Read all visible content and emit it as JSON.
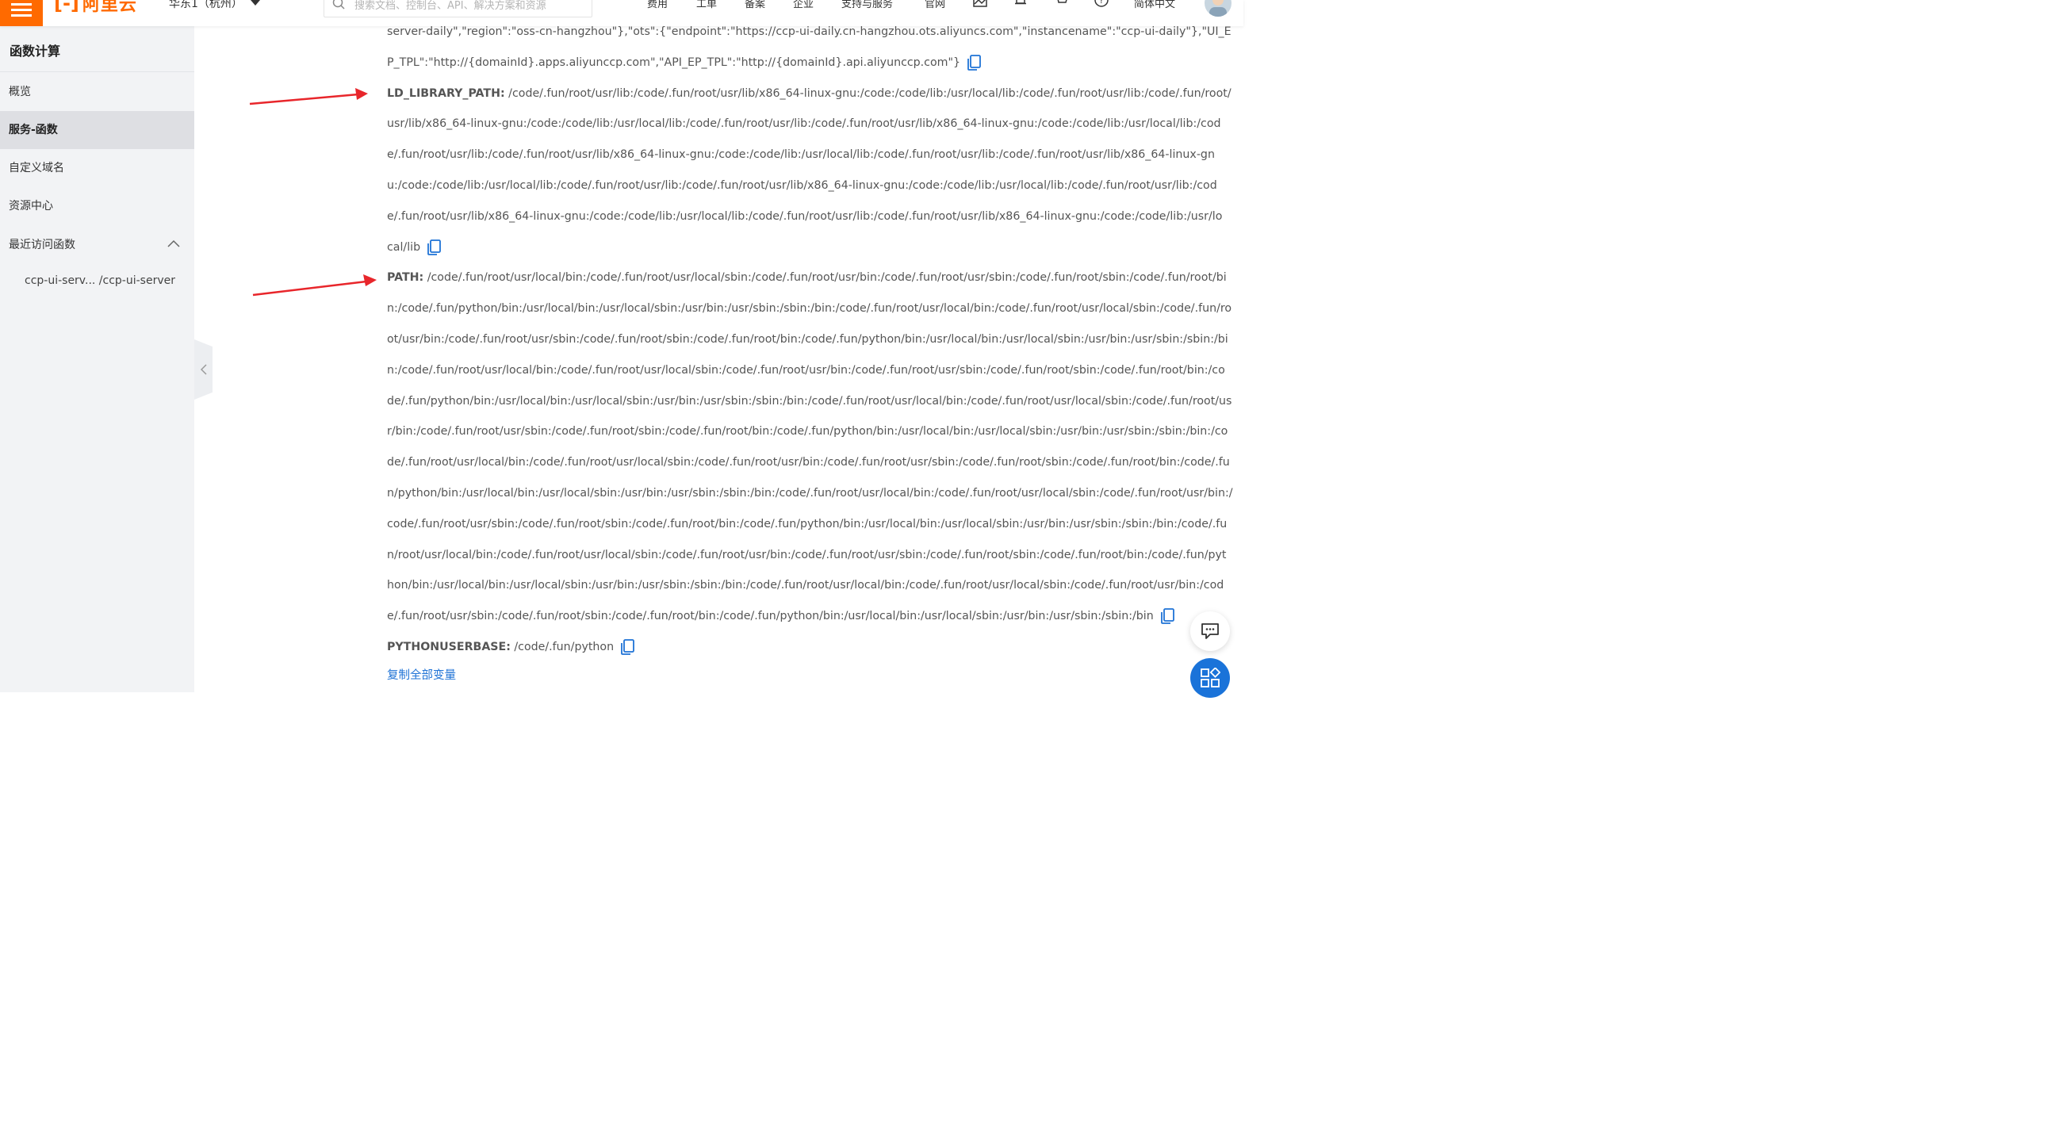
{
  "topbar": {
    "logo_text": "阿里云",
    "region": "华东1（杭州）",
    "search_placeholder": "搜索文档、控制台、API、解决方案和资源",
    "links": [
      "费用",
      "工单",
      "备案",
      "企业",
      "支持与服务",
      "官网"
    ],
    "language": "简体中文"
  },
  "sidebar": {
    "title": "函数计算",
    "items": [
      {
        "label": "概览"
      },
      {
        "label": "服务-函数"
      },
      {
        "label": "自定义域名"
      },
      {
        "label": "资源中心"
      },
      {
        "label": "最近访问函数"
      }
    ],
    "recent": [
      "ccp-ui-serv... /ccp-ui-server"
    ]
  },
  "content": {
    "lines": [
      {
        "key": "",
        "text": "server-daily\",\"region\":\"oss-cn-hangzhou\"},\"ots\":{\"endpoint\":\"https://ccp-ui-daily.cn-hangzhou.ots.aliyuncs.com\",\"instancename\":\"ccp-ui-daily\"},\"UI_E",
        "copy": false
      },
      {
        "key": "",
        "text": "P_TPL\":\"http://{domainId}.apps.aliyunccp.com\",\"API_EP_TPL\":\"http://{domainId}.api.aliyunccp.com\"}",
        "copy": true
      },
      {
        "key": "LD_LIBRARY_PATH:",
        "text": " /code/.fun/root/usr/lib:/code/.fun/root/usr/lib/x86_64-linux-gnu:/code:/code/lib:/usr/local/lib:/code/.fun/root/usr/lib:/code/.fun/root/",
        "copy": false
      },
      {
        "key": "",
        "text": "usr/lib/x86_64-linux-gnu:/code:/code/lib:/usr/local/lib:/code/.fun/root/usr/lib:/code/.fun/root/usr/lib/x86_64-linux-gnu:/code:/code/lib:/usr/local/lib:/cod",
        "copy": false
      },
      {
        "key": "",
        "text": "e/.fun/root/usr/lib:/code/.fun/root/usr/lib/x86_64-linux-gnu:/code:/code/lib:/usr/local/lib:/code/.fun/root/usr/lib:/code/.fun/root/usr/lib/x86_64-linux-gn",
        "copy": false
      },
      {
        "key": "",
        "text": "u:/code:/code/lib:/usr/local/lib:/code/.fun/root/usr/lib:/code/.fun/root/usr/lib/x86_64-linux-gnu:/code:/code/lib:/usr/local/lib:/code/.fun/root/usr/lib:/cod",
        "copy": false
      },
      {
        "key": "",
        "text": "e/.fun/root/usr/lib/x86_64-linux-gnu:/code:/code/lib:/usr/local/lib:/code/.fun/root/usr/lib:/code/.fun/root/usr/lib/x86_64-linux-gnu:/code:/code/lib:/usr/lo",
        "copy": false
      },
      {
        "key": "",
        "text": "cal/lib",
        "copy": true
      },
      {
        "key": "PATH:",
        "text": " /code/.fun/root/usr/local/bin:/code/.fun/root/usr/local/sbin:/code/.fun/root/usr/bin:/code/.fun/root/usr/sbin:/code/.fun/root/sbin:/code/.fun/root/bi",
        "copy": false
      },
      {
        "key": "",
        "text": "n:/code/.fun/python/bin:/usr/local/bin:/usr/local/sbin:/usr/bin:/usr/sbin:/sbin:/bin:/code/.fun/root/usr/local/bin:/code/.fun/root/usr/local/sbin:/code/.fun/ro",
        "copy": false
      },
      {
        "key": "",
        "text": "ot/usr/bin:/code/.fun/root/usr/sbin:/code/.fun/root/sbin:/code/.fun/root/bin:/code/.fun/python/bin:/usr/local/bin:/usr/local/sbin:/usr/bin:/usr/sbin:/sbin:/bi",
        "copy": false
      },
      {
        "key": "",
        "text": "n:/code/.fun/root/usr/local/bin:/code/.fun/root/usr/local/sbin:/code/.fun/root/usr/bin:/code/.fun/root/usr/sbin:/code/.fun/root/sbin:/code/.fun/root/bin:/co",
        "copy": false
      },
      {
        "key": "",
        "text": "de/.fun/python/bin:/usr/local/bin:/usr/local/sbin:/usr/bin:/usr/sbin:/sbin:/bin:/code/.fun/root/usr/local/bin:/code/.fun/root/usr/local/sbin:/code/.fun/root/us",
        "copy": false
      },
      {
        "key": "",
        "text": "r/bin:/code/.fun/root/usr/sbin:/code/.fun/root/sbin:/code/.fun/root/bin:/code/.fun/python/bin:/usr/local/bin:/usr/local/sbin:/usr/bin:/usr/sbin:/sbin:/bin:/co",
        "copy": false
      },
      {
        "key": "",
        "text": "de/.fun/root/usr/local/bin:/code/.fun/root/usr/local/sbin:/code/.fun/root/usr/bin:/code/.fun/root/usr/sbin:/code/.fun/root/sbin:/code/.fun/root/bin:/code/.fu",
        "copy": false
      },
      {
        "key": "",
        "text": "n/python/bin:/usr/local/bin:/usr/local/sbin:/usr/bin:/usr/sbin:/sbin:/bin:/code/.fun/root/usr/local/bin:/code/.fun/root/usr/local/sbin:/code/.fun/root/usr/bin:/",
        "copy": false
      },
      {
        "key": "",
        "text": "code/.fun/root/usr/sbin:/code/.fun/root/sbin:/code/.fun/root/bin:/code/.fun/python/bin:/usr/local/bin:/usr/local/sbin:/usr/bin:/usr/sbin:/sbin:/bin:/code/.fu",
        "copy": false
      },
      {
        "key": "",
        "text": "n/root/usr/local/bin:/code/.fun/root/usr/local/sbin:/code/.fun/root/usr/bin:/code/.fun/root/usr/sbin:/code/.fun/root/sbin:/code/.fun/root/bin:/code/.fun/pyt",
        "copy": false
      },
      {
        "key": "",
        "text": "hon/bin:/usr/local/bin:/usr/local/sbin:/usr/bin:/usr/sbin:/sbin:/bin:/code/.fun/root/usr/local/bin:/code/.fun/root/usr/local/sbin:/code/.fun/root/usr/bin:/cod",
        "copy": false
      },
      {
        "key": "",
        "text": "e/.fun/root/usr/sbin:/code/.fun/root/sbin:/code/.fun/root/bin:/code/.fun/python/bin:/usr/local/bin:/usr/local/sbin:/usr/bin:/usr/sbin:/sbin:/bin",
        "copy": true
      },
      {
        "key": "PYTHONUSERBASE:",
        "text": " /code/.fun/python",
        "copy": true
      }
    ],
    "copy_all_label": "复制全部变量"
  },
  "colors": {
    "brand": "#ff6a00",
    "link": "#1f73d6",
    "annotation_arrow": "#e8262b"
  },
  "icons": [
    "menu-icon",
    "search-icon",
    "caret-down-icon",
    "image-icon",
    "bell-icon",
    "cart-icon",
    "help-icon",
    "chevron-up-icon",
    "chevron-left-icon",
    "copy-icon",
    "chat-icon",
    "apps-icon"
  ]
}
